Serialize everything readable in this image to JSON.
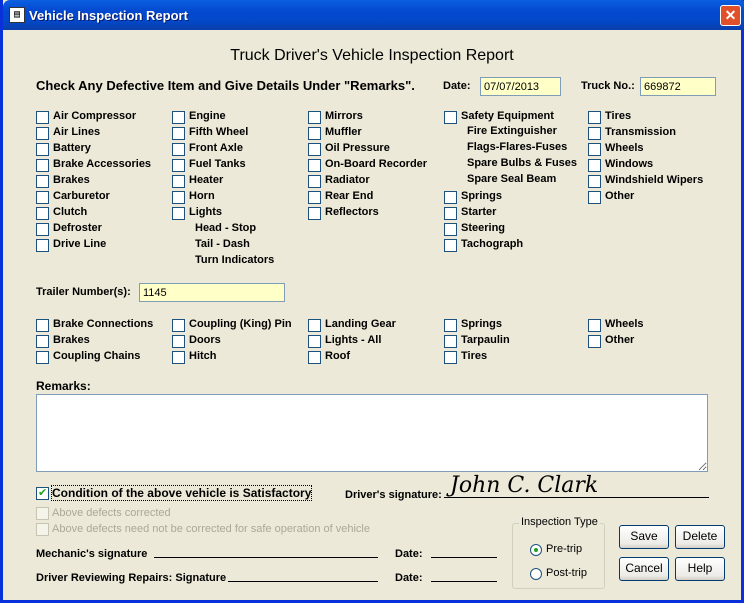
{
  "window": {
    "title": "Vehicle Inspection Report",
    "icon": "app-icon",
    "close_label": "✕"
  },
  "heading": "Truck Driver's Vehicle Inspection Report",
  "instruction": "Check Any Defective Item and Give Details Under \"Remarks\".",
  "date": {
    "label": "Date:",
    "value": "07/07/2013"
  },
  "truck": {
    "label": "Truck No.:",
    "value": "669872"
  },
  "truck_items": {
    "col1": [
      "Air Compressor",
      "Air Lines",
      "Battery",
      "Brake  Accessories",
      "Brakes",
      "Carburetor",
      "Clutch",
      "Defroster",
      "Drive Line"
    ],
    "col2": [
      "Engine",
      "Fifth Wheel",
      "Front Axle",
      "Fuel Tanks",
      "Heater",
      "Horn",
      "Lights"
    ],
    "col2_sub": [
      "Head - Stop",
      "Tail - Dash",
      "Turn Indicators"
    ],
    "col3": [
      "Mirrors",
      "Muffler",
      "Oil Pressure",
      "On-Board Recorder",
      "Radiator",
      "Rear End",
      "Reflectors"
    ],
    "col4_top": "Safety Equipment",
    "col4_sub": [
      "Fire Extinguisher",
      "Flags-Flares-Fuses",
      "Spare Bulbs & Fuses",
      "Spare Seal Beam"
    ],
    "col4": [
      "Springs",
      "Starter",
      "Steering",
      "Tachograph"
    ],
    "col5": [
      "Tires",
      "Transmission",
      "Wheels",
      "Windows",
      "Windshield Wipers",
      "Other"
    ]
  },
  "trailer": {
    "label": "Trailer Number(s):",
    "value": "1145"
  },
  "trailer_items": {
    "col1": [
      "Brake Connections",
      "Brakes",
      "Coupling Chains"
    ],
    "col2": [
      "Coupling (King) Pin",
      "Doors",
      "Hitch"
    ],
    "col3": [
      "Landing Gear",
      "Lights - All",
      "Roof"
    ],
    "col4": [
      "Springs",
      "Tarpaulin",
      "Tires"
    ],
    "col5": [
      "Wheels",
      "Other"
    ]
  },
  "remarks": {
    "label": "Remarks:",
    "value": ""
  },
  "condition": {
    "satisfactory": "Condition of the above vehicle is Satisfactory",
    "corrected": "Above defects corrected",
    "not_needed": "Above defects need not be corrected for safe operation of vehicle"
  },
  "driver_signature": {
    "label": "Driver's signature:",
    "value": "John C. Clark"
  },
  "mechanic_signature": {
    "label": "Mechanic's signature",
    "date_label": "Date:"
  },
  "reviewing_signature": {
    "label": "Driver Reviewing Repairs: Signature",
    "date_label": "Date:"
  },
  "inspection_type": {
    "label": "Inspection Type",
    "options": [
      "Pre-trip",
      "Post-trip"
    ],
    "selected": "Pre-trip"
  },
  "buttons": {
    "save": "Save",
    "delete": "Delete",
    "cancel": "Cancel",
    "help": "Help"
  }
}
